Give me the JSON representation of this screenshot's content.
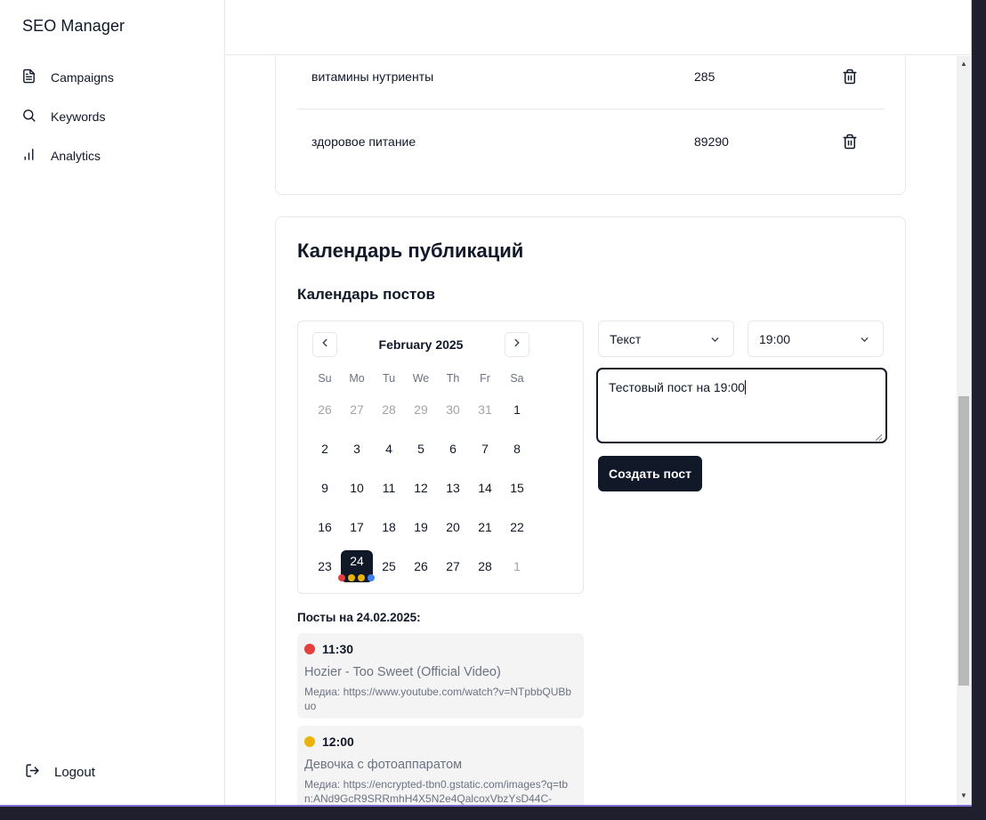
{
  "app": {
    "brand": "SEO Manager"
  },
  "sidebar": {
    "items": [
      {
        "label": "Campaigns",
        "icon": "document-icon"
      },
      {
        "label": "Keywords",
        "icon": "search-icon"
      },
      {
        "label": "Analytics",
        "icon": "bar-chart-icon"
      }
    ],
    "logout": "Logout"
  },
  "keywords": {
    "rows": [
      {
        "keyword": "витамины нутриенты",
        "volume": "285"
      },
      {
        "keyword": "здоровое питание",
        "volume": "89290"
      }
    ]
  },
  "calendar_section": {
    "title": "Календарь публикаций",
    "subtitle": "Календарь постов",
    "month": "February 2025",
    "weekdays": [
      "Su",
      "Mo",
      "Tu",
      "We",
      "Th",
      "Fr",
      "Sa"
    ],
    "weeks": [
      [
        "26",
        "27",
        "28",
        "29",
        "30",
        "31",
        "1"
      ],
      [
        "2",
        "3",
        "4",
        "5",
        "6",
        "7",
        "8"
      ],
      [
        "9",
        "10",
        "11",
        "12",
        "13",
        "14",
        "15"
      ],
      [
        "16",
        "17",
        "18",
        "19",
        "20",
        "21",
        "22"
      ],
      [
        "23",
        "24",
        "25",
        "26",
        "27",
        "28",
        "1"
      ]
    ],
    "selected_day": "24",
    "selected_day_dots": [
      "#e53e3e",
      "#eab308",
      "#eab308",
      "#3b82f6"
    ]
  },
  "composer": {
    "type_select": "Текст",
    "time_select": "19:00",
    "text": "Тестовый пост на 19:00",
    "submit": "Создать пост"
  },
  "posts": {
    "heading": "Посты на 24.02.2025:",
    "items": [
      {
        "time": "11:30",
        "color": "#e53e3e",
        "title": "Hozier - Too Sweet (Official Video)",
        "media": "Медиа: https://www.youtube.com/watch?v=NTpbbQUBbuo"
      },
      {
        "time": "12:00",
        "color": "#eab308",
        "title": "Девочка с фотоаппаратом",
        "media": "Медиа: https://encrypted-tbn0.gstatic.com/images?q=tbn:ANd9GcR9SRRmhH4X5N2e4QalcoxVbzYsD44C-"
      }
    ]
  }
}
